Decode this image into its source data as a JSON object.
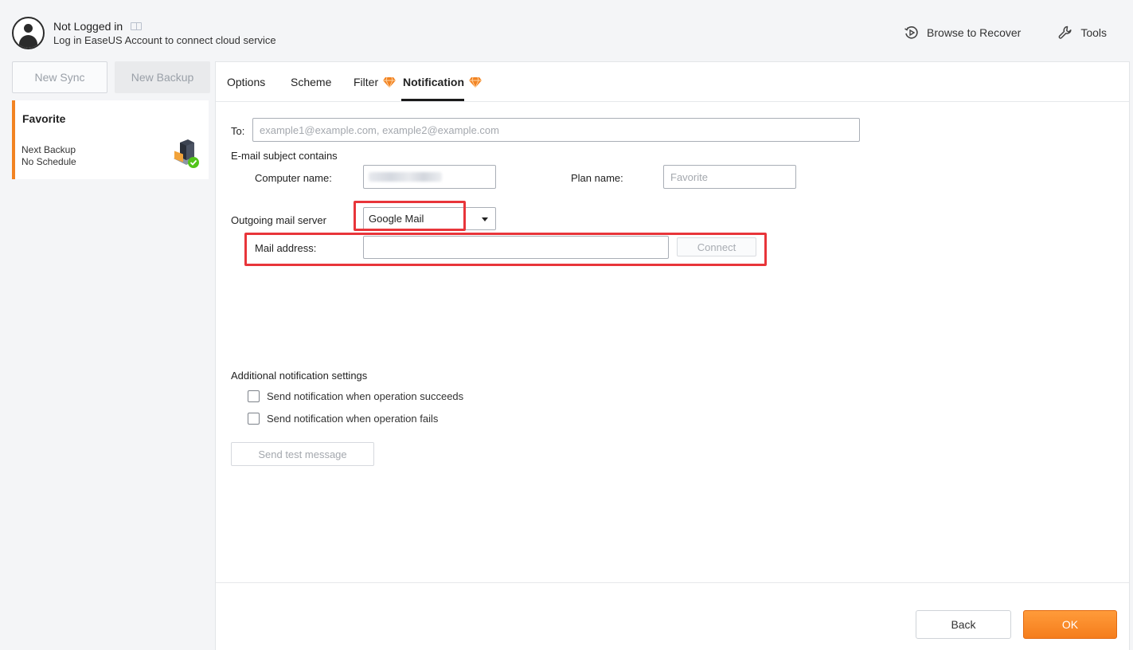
{
  "account": {
    "title": "Not Logged in",
    "subtitle": "Log in EaseUS Account to connect cloud service"
  },
  "top_actions": {
    "browse": "Browse to Recover",
    "tools": "Tools"
  },
  "sidebar": {
    "new_sync": "New Sync",
    "new_backup": "New Backup",
    "plan": {
      "title": "Favorite",
      "next_label": "Next Backup",
      "next_value": "No Schedule"
    }
  },
  "tabs": [
    {
      "label": "Options"
    },
    {
      "label": "Scheme"
    },
    {
      "label": "Filter"
    },
    {
      "label": "Notification"
    }
  ],
  "form": {
    "to_label": "To:",
    "to_placeholder": "example1@example.com, example2@example.com",
    "subject_label": "E-mail subject contains",
    "computer_label": "Computer name:",
    "plan_label": "Plan name:",
    "plan_placeholder": "Favorite",
    "server_label": "Outgoing mail server",
    "server_value": "Google Mail",
    "mail_label": "Mail address:",
    "mail_value": "",
    "connect": "Connect",
    "additional_label": "Additional notification settings",
    "check_success": "Send notification when operation succeeds",
    "check_fail": "Send notification when operation fails",
    "test": "Send test message"
  },
  "footer": {
    "back": "Back",
    "ok": "OK"
  },
  "colors": {
    "accent": "#f57d1c",
    "highlight": "#e8353a",
    "success": "#52c41a"
  }
}
